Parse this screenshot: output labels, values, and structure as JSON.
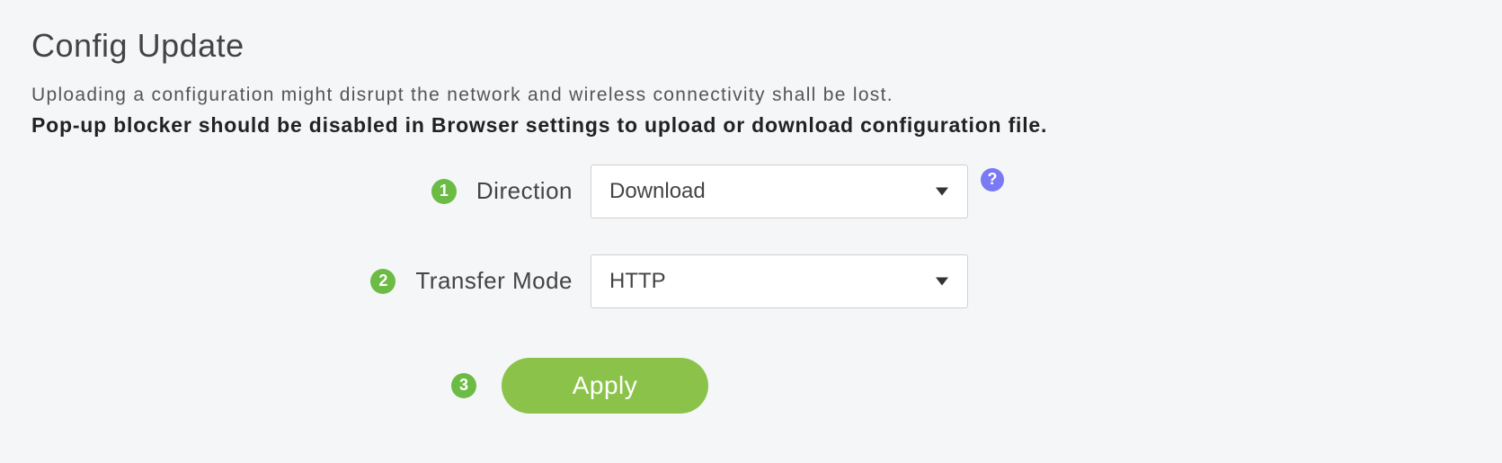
{
  "title": "Config Update",
  "description": "Uploading a configuration might disrupt the network and wireless connectivity shall be lost.",
  "warning": "Pop-up blocker should be disabled in Browser settings to upload or download configuration file.",
  "badges": {
    "direction": "1",
    "transfer_mode": "2",
    "apply": "3"
  },
  "form": {
    "direction": {
      "label": "Direction",
      "value": "Download"
    },
    "transfer_mode": {
      "label": "Transfer Mode",
      "value": "HTTP"
    }
  },
  "help_symbol": "?",
  "buttons": {
    "apply": "Apply"
  }
}
